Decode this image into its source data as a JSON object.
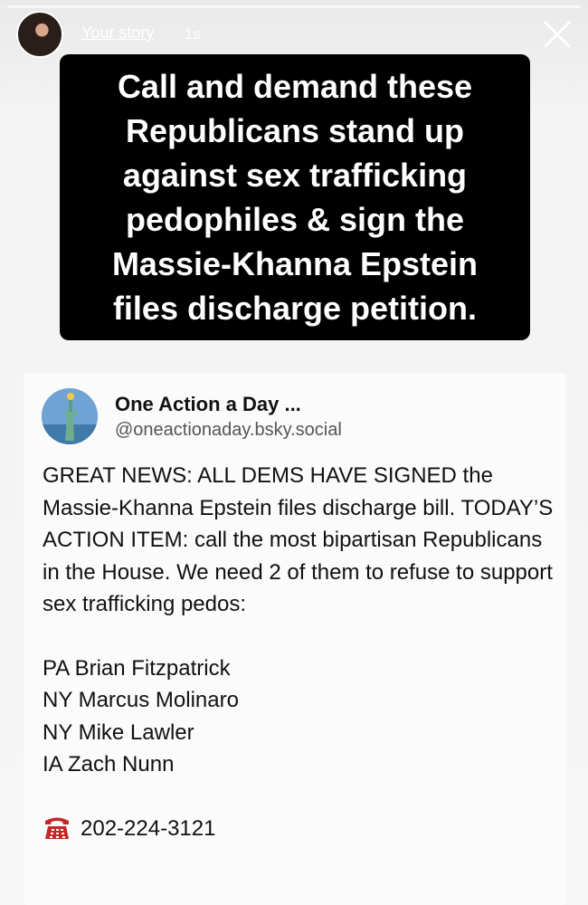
{
  "story": {
    "username": "Your story",
    "time_ago": "1s",
    "banner_text": "Call and demand these\nRepublicans stand up\nagainst sex trafficking\npedophiles & sign the\nMassie-Khanna Epstein\nfiles discharge petition."
  },
  "post": {
    "display_name": "One Action a Day ...",
    "handle": "@oneactionaday.bsky.social",
    "body": "GREAT NEWS: ALL DEMS HAVE SIGNED the Massie-Khanna Epstein files discharge bill. TODAY’S ACTION ITEM: call the most bipartisan Republicans in the House. We need 2 of them to refuse to support sex trafficking pedos:",
    "representatives": [
      "PA Brian Fitzpatrick",
      "NY Marcus Molinaro",
      "NY Mike Lawler",
      "IA Zach Nunn"
    ],
    "phone_icon": "telephone-icon",
    "phone": "202-224-3121"
  },
  "colors": {
    "banner_bg": "#000000",
    "banner_text": "#ffffff",
    "card_bg": "#fbfbfb",
    "phone_icon": "#c62828"
  }
}
